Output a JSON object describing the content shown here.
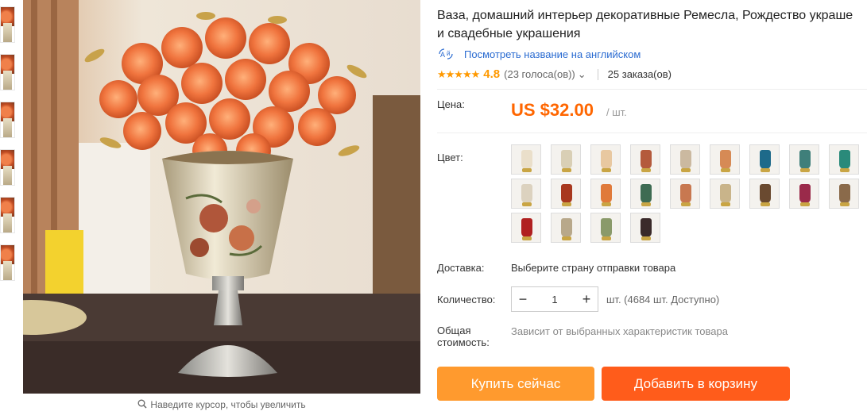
{
  "gallery": {
    "thumbnail_count": 6,
    "zoom_hint": "Наведите курсор, чтобы увеличить"
  },
  "product": {
    "title_line1": "Ваза, домашний интерьер декоративные Ремесла, Рождество украше",
    "title_line2": "и свадебные украшения",
    "translate_link": "Посмотреть название на английском",
    "stars": "★★★★★",
    "rating": "4.8",
    "votes": "(23 голоса(ов))",
    "votes_caret": "⌄",
    "orders": "25 заказа(ов)"
  },
  "price": {
    "label": "Цена:",
    "value": "US $32.00",
    "unit": "/ шт."
  },
  "color": {
    "label": "Цвет:",
    "swatches": [
      {
        "vase": "#eadfca"
      },
      {
        "vase": "#d9cfb5"
      },
      {
        "vase": "#e8c8a0"
      },
      {
        "vase": "#b45a3c"
      },
      {
        "vase": "#cbb9a0"
      },
      {
        "vase": "#d68a55"
      },
      {
        "vase": "#1e6a8a"
      },
      {
        "vase": "#3f7f7a"
      },
      {
        "vase": "#2a8a7a"
      },
      {
        "vase": "#dcd2bf"
      },
      {
        "vase": "#a8381e"
      },
      {
        "vase": "#e07a3a"
      },
      {
        "vase": "#3e6b52"
      },
      {
        "vase": "#c87850"
      },
      {
        "vase": "#c9b48a"
      },
      {
        "vase": "#6a4a30"
      },
      {
        "vase": "#9a2a4a"
      },
      {
        "vase": "#8a6a4a"
      },
      {
        "vase": "#b02020"
      },
      {
        "vase": "#b8a88a"
      },
      {
        "vase": "#8a9a6a"
      },
      {
        "vase": "#3a2a2a"
      }
    ]
  },
  "shipping": {
    "label": "Доставка:",
    "value": "Выберите страну отправки товара"
  },
  "quantity": {
    "label": "Количество:",
    "minus": "−",
    "value": "1",
    "plus": "+",
    "available": "шт. (4684 шт. Доступно)"
  },
  "total": {
    "label_line1": "Общая",
    "label_line2": "стоимость:",
    "value": "Зависит от выбранных характеристик товара"
  },
  "actions": {
    "buy_now": "Купить сейчас",
    "add_to_cart": "Добавить в корзину"
  },
  "colors": {
    "accent": "#ff6600",
    "buy_button": "#ff9a2e",
    "cart_button": "#ff5c1b",
    "link": "#2a6bd1",
    "star": "#ff9900"
  }
}
